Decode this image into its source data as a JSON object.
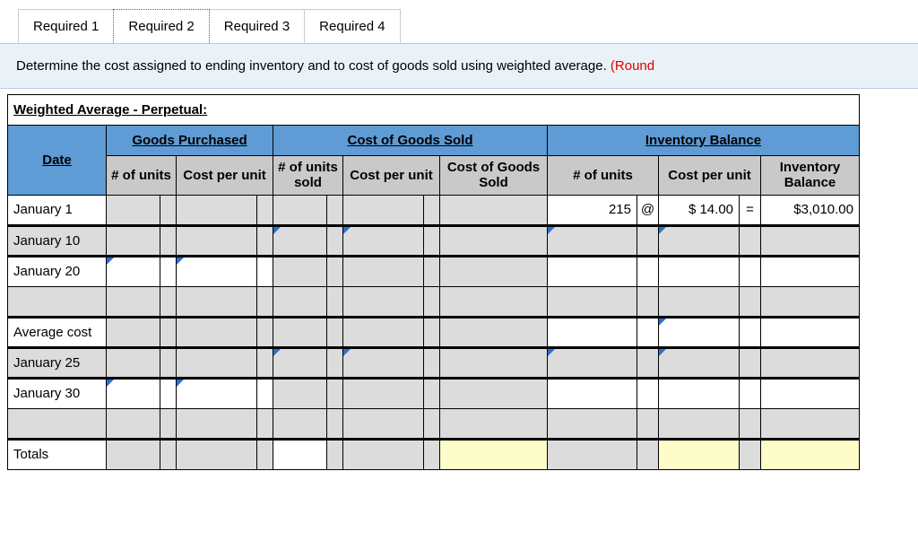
{
  "tabs": [
    "Required 1",
    "Required 2",
    "Required 3",
    "Required 4"
  ],
  "active_tab": 1,
  "instruction": {
    "text": "Determine the cost assigned to ending inventory and to cost of goods sold using weighted average. ",
    "suffix": "(Round"
  },
  "table": {
    "title": "Weighted Average - Perpetual:",
    "sections": {
      "goods_purchased": "Goods Purchased",
      "cogs": "Cost of Goods Sold",
      "inventory": "Inventory Balance"
    },
    "cols": {
      "date": "Date",
      "units1": "# of units",
      "cpu1": "Cost per unit",
      "units_sold": "# of units sold",
      "cpu2": "Cost per unit",
      "cogs_col": "Cost of Goods Sold",
      "units3": "# of units",
      "cpu3": "Cost per unit",
      "balance": "Inventory Balance"
    },
    "rows": {
      "jan1": {
        "date": "January 1",
        "inv_units": "215",
        "at": "@",
        "inv_cpu": "$ 14.00",
        "eq": "=",
        "inv_bal": "$3,010.00"
      },
      "jan10": {
        "date": "January 10"
      },
      "jan20": {
        "date": "January 20"
      },
      "blank1": {
        "date": ""
      },
      "avgcost": {
        "date": "Average cost"
      },
      "jan25": {
        "date": "January 25"
      },
      "jan30": {
        "date": "January 30"
      },
      "blank2": {
        "date": ""
      },
      "totals": {
        "date": "Totals"
      }
    }
  }
}
